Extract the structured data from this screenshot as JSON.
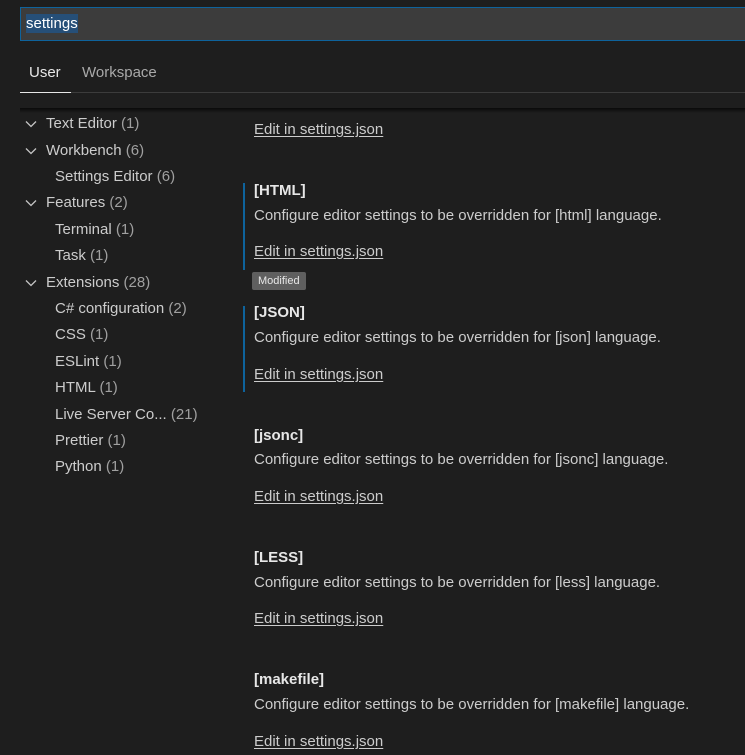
{
  "search": {
    "value": "settings"
  },
  "tabs": [
    {
      "label": "User"
    },
    {
      "label": "Workspace"
    }
  ],
  "toc": [
    {
      "label": "Text Editor",
      "count": "(1)"
    },
    {
      "label": "Workbench",
      "count": "(6)"
    },
    {
      "label": "Settings Editor",
      "count": "(6)"
    },
    {
      "label": "Features",
      "count": "(2)"
    },
    {
      "label": "Terminal",
      "count": "(1)"
    },
    {
      "label": "Task",
      "count": "(1)"
    },
    {
      "label": "Extensions",
      "count": "(28)"
    },
    {
      "label": "C# configuration",
      "count": "(2)"
    },
    {
      "label": "CSS",
      "count": "(1)"
    },
    {
      "label": "ESLint",
      "count": "(1)"
    },
    {
      "label": "HTML",
      "count": "(1)"
    },
    {
      "label": "Live Server Co...",
      "count": "(21)"
    },
    {
      "label": "Prettier",
      "count": "(1)"
    },
    {
      "label": "Python",
      "count": "(1)"
    }
  ],
  "settings": {
    "top_link": "Edit in settings.json",
    "modified_badge": "Modified",
    "sections": [
      {
        "title": "[HTML]",
        "description": "Configure editor settings to be overridden for [html] language.",
        "link": "Edit in settings.json"
      },
      {
        "title": "[JSON]",
        "description": "Configure editor settings to be overridden for [json] language.",
        "link": "Edit in settings.json"
      },
      {
        "title": "[jsonc]",
        "description": "Configure editor settings to be overridden for [jsonc] language.",
        "link": "Edit in settings.json"
      },
      {
        "title": "[LESS]",
        "description": "Configure editor settings to be overridden for [less] language.",
        "link": "Edit in settings.json"
      },
      {
        "title": "[makefile]",
        "description": "Configure editor settings to be overridden for [makefile] language.",
        "link": "Edit in settings.json"
      }
    ]
  },
  "colors": {
    "background": "#1e1e1e",
    "focus_border": "#0e639c",
    "modified_indicator": "#0e639c",
    "selection": "#264f78"
  }
}
